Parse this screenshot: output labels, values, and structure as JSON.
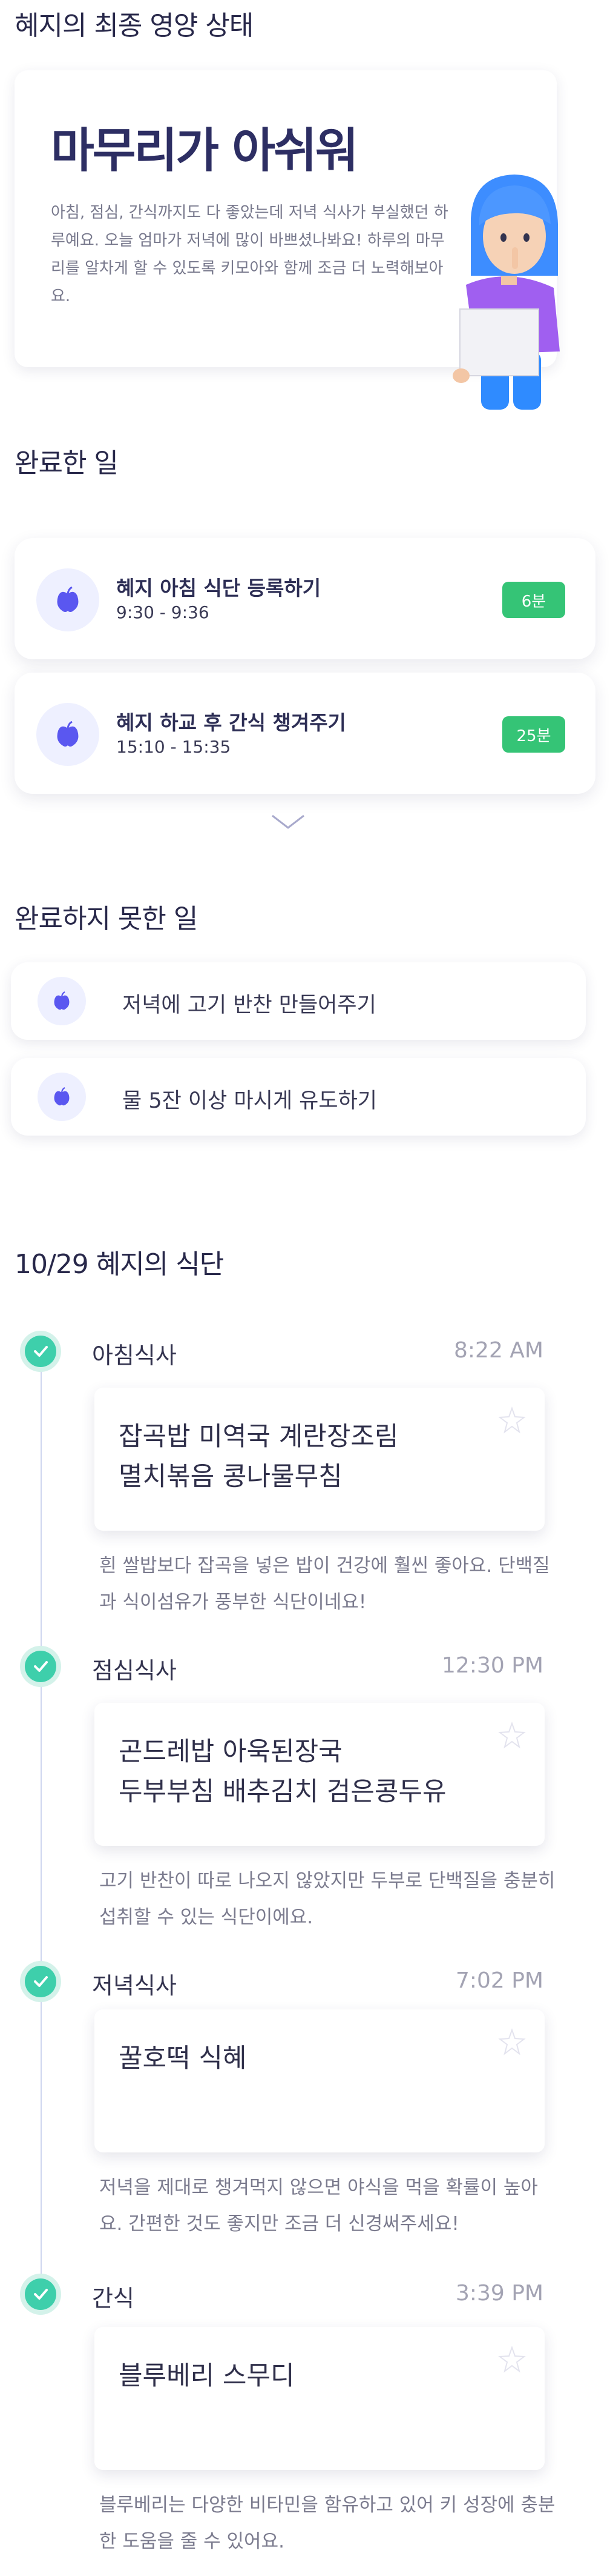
{
  "status": {
    "section_title": "혜지의 최종 영양 상태",
    "headline": "마무리가 아쉬워",
    "body": "아침, 점심, 간식까지도 다 좋았는데 저녁 식사가 부실했던 하루예요. 오늘 엄마가 저녁에 많이 바쁘셨나봐요! 하루의 마무리를 알차게 할 수 있도록 키모아와 함께 조금 더 노력해보아요."
  },
  "done": {
    "section_title": "완료한 일",
    "items": [
      {
        "title": "혜지 아침 식단 등록하기",
        "time": "9:30 - 9:36",
        "badge": "6분",
        "icon": "apple-icon"
      },
      {
        "title": "혜지 하교 후 간식 챙겨주기",
        "time": "15:10 - 15:35",
        "badge": "25분",
        "icon": "apple-icon"
      }
    ]
  },
  "undone": {
    "section_title": "완료하지 못한 일",
    "items": [
      {
        "label": "저녁에 고기 반찬 만들어주기",
        "icon": "apple-icon"
      },
      {
        "label": "물 5잔 이상 마시게 유도하기",
        "icon": "apple-icon"
      }
    ]
  },
  "diet": {
    "section_title": "10/29 혜지의 식단",
    "meals": [
      {
        "name": "아침식사",
        "time": "8:22 AM",
        "foods_line1": "잡곡밥  미역국  계란장조림",
        "foods_line2": "멸치볶음  콩나물무침",
        "comment": "흰 쌀밥보다 잡곡을 넣은 밥이 건강에 훨씬 좋아요. 단백질과 식이섬유가 풍부한 식단이네요!"
      },
      {
        "name": "점심식사",
        "time": "12:30 PM",
        "foods_line1": "곤드레밥  아욱된장국",
        "foods_line2": "두부부침  배추김치  검은콩두유",
        "comment": "고기 반찬이 따로 나오지 않았지만 두부로 단백질을 충분히 섭취할 수 있는 식단이에요."
      },
      {
        "name": "저녁식사",
        "time": "7:02 PM",
        "foods_line1": "꿀호떡  식혜",
        "foods_line2": "",
        "comment": "저녁을 제대로 챙겨먹지 않으면 야식을 먹을 확률이 높아요. 간편한 것도 좋지만 조금 더 신경써주세요!"
      },
      {
        "name": "간식",
        "time": "3:39 PM",
        "foods_line1": "블루베리 스무디",
        "foods_line2": "",
        "comment": "블루베리는 다양한 비타민을 함유하고 있어 키 성장에 충분한 도움을 줄 수 있어요."
      }
    ]
  },
  "colors": {
    "accent": "#5a57f0",
    "badge": "#35c476",
    "check": "#3ecfab",
    "title": "#2d2e63"
  }
}
